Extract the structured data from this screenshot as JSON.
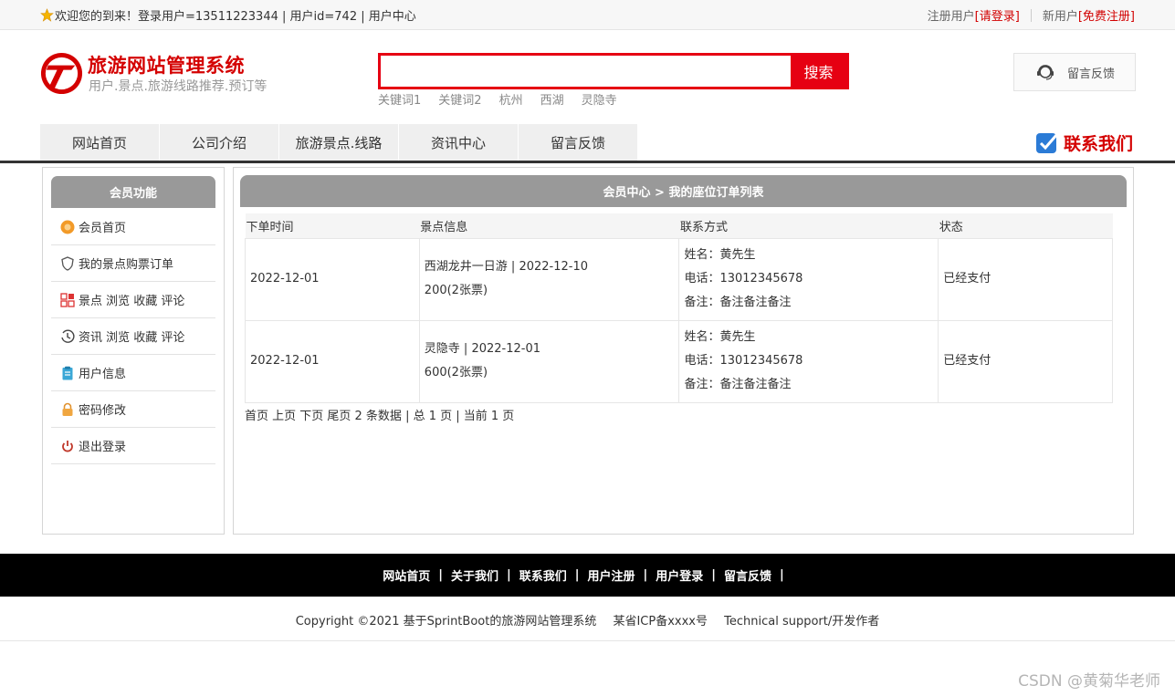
{
  "topbar": {
    "welcome": "欢迎您的到来！登录用户=13511223344 | 用户id=742 | 用户中心",
    "registered_label": "注册用户",
    "login_link": "[请登录]",
    "new_user_label": "新用户",
    "signup_link": "[免费注册]"
  },
  "header": {
    "title": "旅游网站管理系统",
    "subtitle": "用户.景点.旅游线路推荐.预订等",
    "search_placeholder": "",
    "search_button": "搜索",
    "keywords": [
      "关键词1",
      "关键词2",
      "杭州",
      "西湖",
      "灵隐寺"
    ],
    "feedback": "留言反馈"
  },
  "nav": {
    "items": [
      "网站首页",
      "公司介绍",
      "旅游景点.线路",
      "资讯中心",
      "留言反馈"
    ],
    "contact": "联系我们"
  },
  "sidebar": {
    "title": "会员功能",
    "items": [
      {
        "label": "会员首页",
        "icon": "home-icon"
      },
      {
        "label": "我的景点购票订单",
        "icon": "shield-icon"
      },
      {
        "label": "景点 浏览 收藏 评论",
        "icon": "grid-icon"
      },
      {
        "label": "资讯 浏览 收藏 评论",
        "icon": "clock-icon"
      },
      {
        "label": "用户信息",
        "icon": "clipboard-icon"
      },
      {
        "label": "密码修改",
        "icon": "lock-icon"
      },
      {
        "label": "退出登录",
        "icon": "power-icon"
      }
    ]
  },
  "main": {
    "title": "会员中心 > 我的座位订单列表",
    "columns": [
      "下单时间",
      "景点信息",
      "联系方式",
      "状态"
    ],
    "rows": [
      {
        "time": "2022-12-01",
        "spot": "西湖龙井一日游 | 2022-12-10",
        "price": "200(2张票)",
        "name": "姓名：黄先生",
        "phone": "电话：13012345678",
        "note": "备注：备注备注备注",
        "status": "已经支付"
      },
      {
        "time": "2022-12-01",
        "spot": "灵隐寺 | 2022-12-01",
        "price": "600(2张票)",
        "name": "姓名：黄先生",
        "phone": "电话：13012345678",
        "note": "备注：备注备注备注",
        "status": "已经支付"
      }
    ],
    "pager": "首页 上页 下页 尾页 2 条数据 | 总 1 页 | 当前 1 页"
  },
  "footer": {
    "links": [
      "网站首页",
      "关于我们",
      "联系我们",
      "用户注册",
      "用户登录",
      "留言反馈"
    ],
    "copyright": "Copyright ©2021 基于SprintBoot的旅游网站管理系统",
    "icp": "某省ICP备xxxx号",
    "support": "Technical support/开发作者"
  },
  "watermark": "CSDN @黄菊华老师",
  "colors": {
    "brand_red": "#e60012",
    "panel_gray": "#999999"
  }
}
